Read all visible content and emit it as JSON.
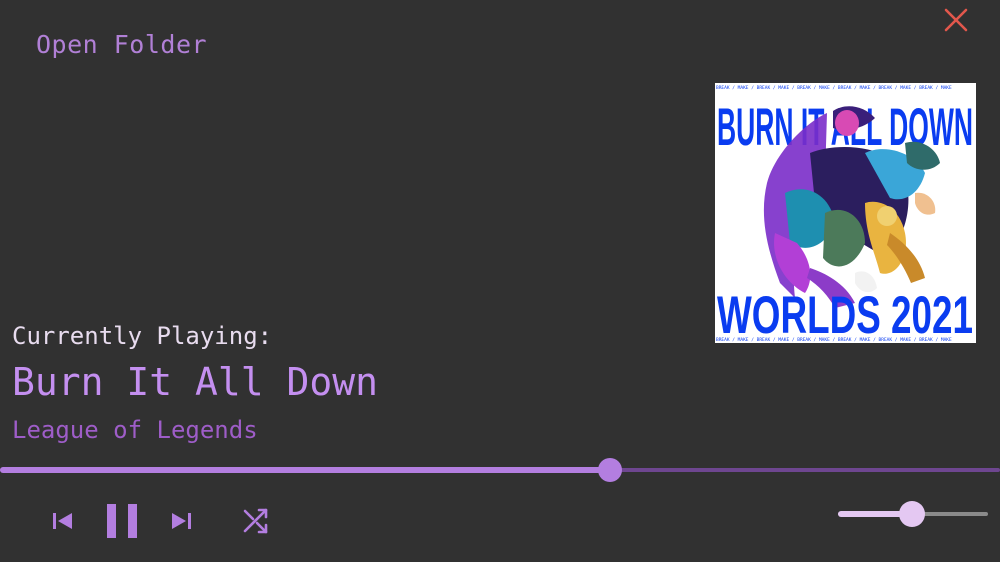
{
  "window": {
    "close_icon": "close-icon",
    "close_color": "#e2574c"
  },
  "header": {
    "open_folder_label": "Open Folder"
  },
  "album_art": {
    "top_text": "BURN IT ALL DOWN",
    "bottom_text": "WORLDS 2021",
    "strip_text": "BREAK / MAKE / BREAK / MAKE / BREAK / MAKE / BREAK / MAKE / BREAK / MAKE / BREAK / MAKE",
    "text_color": "#0a3cf0"
  },
  "now_playing": {
    "label": "Currently Playing:",
    "title": "Burn It All Down",
    "artist": "League of Legends"
  },
  "playback": {
    "progress": 0.61,
    "state": "playing",
    "volume": 0.49
  },
  "controls": {
    "previous_icon": "skip-previous-icon",
    "pause_icon": "pause-icon",
    "next_icon": "skip-next-icon",
    "shuffle_icon": "shuffle-icon"
  },
  "colors": {
    "background": "#313131",
    "accent": "#b37ee0",
    "seek_remaining": "#6e4690",
    "volume_accent": "#e4c8f2"
  }
}
